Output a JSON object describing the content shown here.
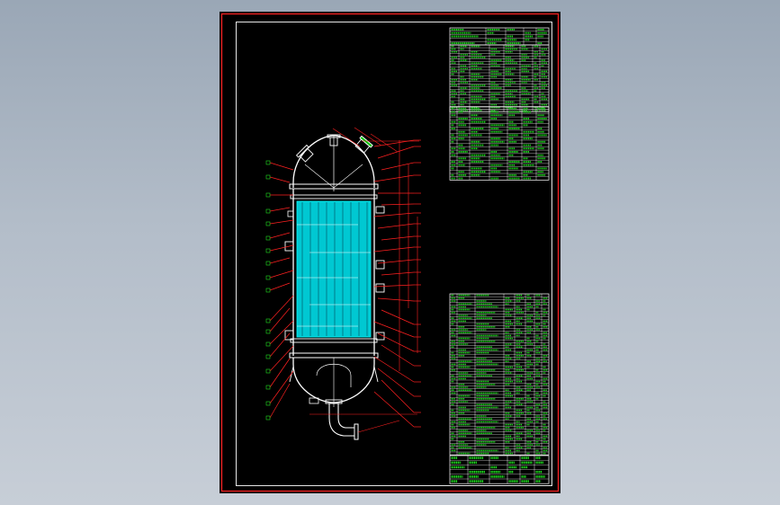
{
  "viewer": {
    "background_top": "#9aa7b6",
    "background_bottom": "#c7ced7"
  },
  "drawing": {
    "type": "vertical-shell-and-tube-heat-exchanger",
    "colors": {
      "sheet": "#000000",
      "frame": "#ff0000",
      "inner_border": "#ffffff",
      "shell": "#ffffff",
      "tubes": "#00e5e5",
      "leaders": "#ff2020",
      "table_lines": "#ffffff",
      "table_text": "#20e020",
      "nozzle_fill": "#00d000"
    },
    "tables": {
      "tech_spec_title": "",
      "nozzle_table_title": "",
      "parts_list_title": "",
      "title_block_text": ""
    }
  }
}
